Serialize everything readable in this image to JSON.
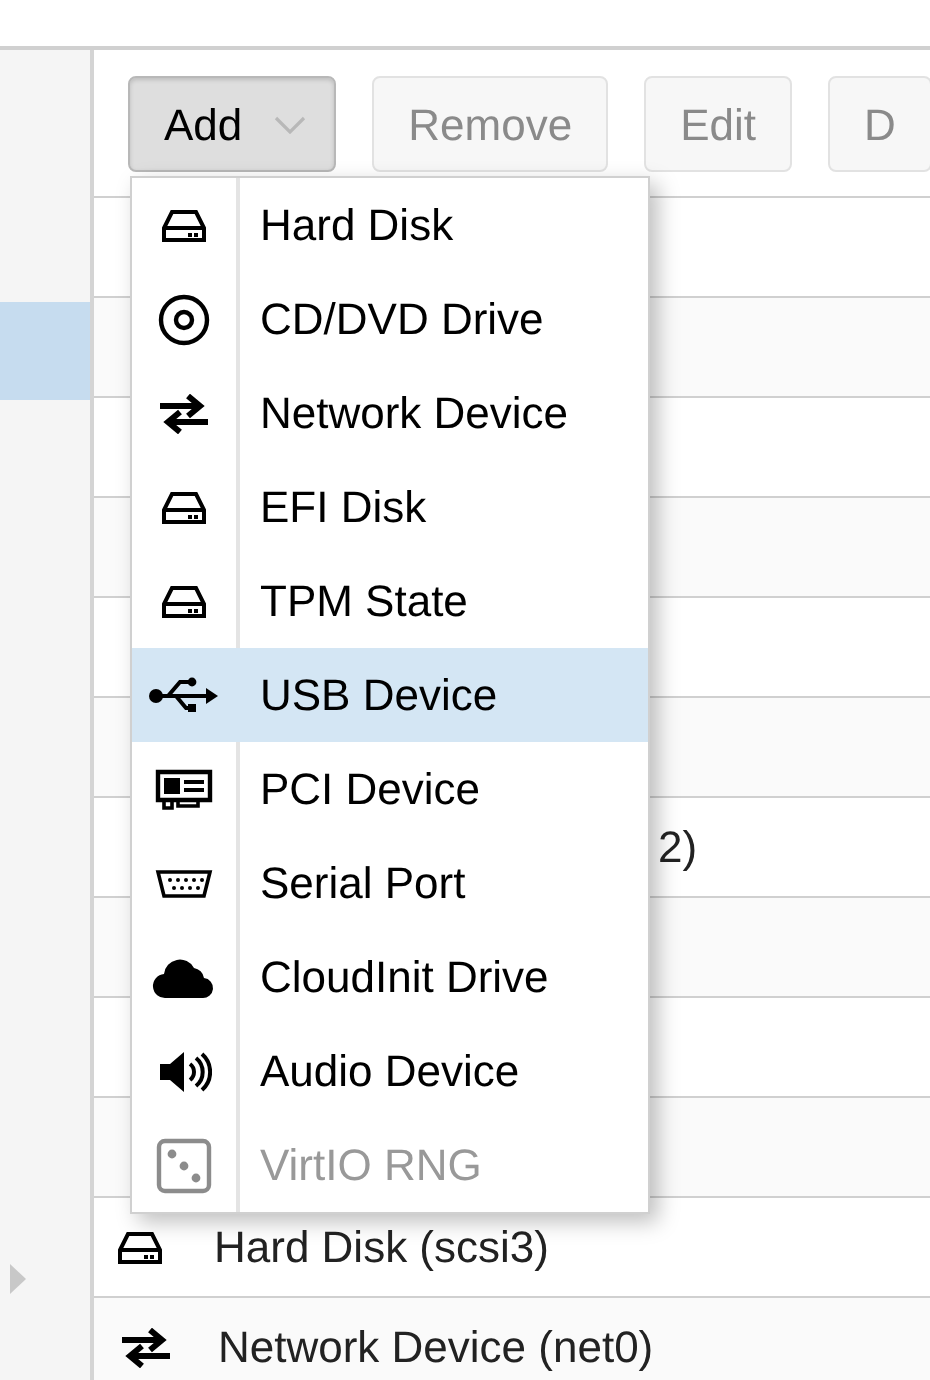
{
  "toolbar": {
    "buttons": [
      {
        "label": "Add",
        "kind": "menu",
        "pressed": true,
        "disabled": false
      },
      {
        "label": "Remove",
        "kind": "plain",
        "pressed": false,
        "disabled": true
      },
      {
        "label": "Edit",
        "kind": "plain",
        "pressed": false,
        "disabled": true
      },
      {
        "label": "D",
        "kind": "plain",
        "pressed": false,
        "disabled": true
      }
    ]
  },
  "add_menu": {
    "items": [
      {
        "label": "Hard Disk",
        "kind": "disk",
        "selected": false,
        "disabled": false
      },
      {
        "label": "CD/DVD Drive",
        "kind": "disc",
        "selected": false,
        "disabled": false
      },
      {
        "label": "Network Device",
        "kind": "network",
        "selected": false,
        "disabled": false
      },
      {
        "label": "EFI Disk",
        "kind": "disk",
        "selected": false,
        "disabled": false
      },
      {
        "label": "TPM State",
        "kind": "disk",
        "selected": false,
        "disabled": false
      },
      {
        "label": "USB Device",
        "kind": "usb",
        "selected": true,
        "disabled": false
      },
      {
        "label": "PCI Device",
        "kind": "pci",
        "selected": false,
        "disabled": false
      },
      {
        "label": "Serial Port",
        "kind": "serial",
        "selected": false,
        "disabled": false
      },
      {
        "label": "CloudInit Drive",
        "kind": "cloud",
        "selected": false,
        "disabled": false
      },
      {
        "label": "Audio Device",
        "kind": "audio",
        "selected": false,
        "disabled": false
      },
      {
        "label": "VirtIO RNG",
        "kind": "rng",
        "selected": false,
        "disabled": true
      }
    ]
  },
  "table": {
    "rows": [
      {
        "kind": "covered"
      },
      {
        "kind": "covered"
      },
      {
        "kind": "covered"
      },
      {
        "kind": "covered"
      },
      {
        "kind": "covered"
      },
      {
        "kind": "covered"
      },
      {
        "kind": "covered",
        "text": "2)"
      },
      {
        "kind": "covered"
      },
      {
        "kind": "covered"
      },
      {
        "kind": "covered"
      },
      {
        "kind": "disk",
        "text": "Hard Disk (scsi3)"
      },
      {
        "kind": "network",
        "text": "Network Device (net0)"
      }
    ]
  }
}
